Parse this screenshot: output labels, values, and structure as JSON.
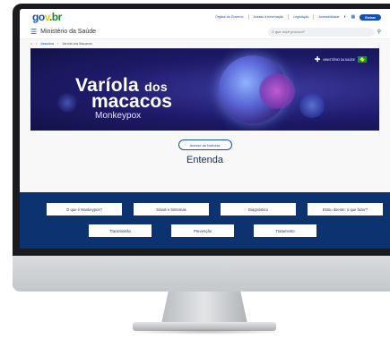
{
  "gov": {
    "logo_g1": "go",
    "logo_g2": "v",
    "logo_g3": ".br",
    "links": [
      "Órgãos do Governo",
      "Acesso à Informação",
      "Legislação",
      "Acessibilidade"
    ],
    "signin_label": "Entrar"
  },
  "ms": {
    "title": "Ministério da Saúde",
    "search_placeholder": "O que você procura?"
  },
  "breadcrumb": {
    "items": [
      "Assuntos",
      "Varíola dos Macacos"
    ]
  },
  "banner": {
    "line1_main": "Varíola",
    "line1_small": "dos",
    "line2": "macacos",
    "line3": "Monkeypox",
    "ministry_label": "MINISTÉRIO DA SAÚDE"
  },
  "news_button_label": "Acesse as Notícias",
  "section_title": "Entenda",
  "topics_row1": [
    "O que é Monkeypox?",
    "Sinais e Sintomas",
    "Diagnóstico",
    "Estou doente: o que fazer?"
  ],
  "topics_row2": [
    "Transmissão",
    "Prevenção",
    "Tratamento"
  ],
  "colors": {
    "gov_blue": "#1351b4",
    "section_blue": "#0c326f",
    "banner_purple": "#1d1a68"
  }
}
